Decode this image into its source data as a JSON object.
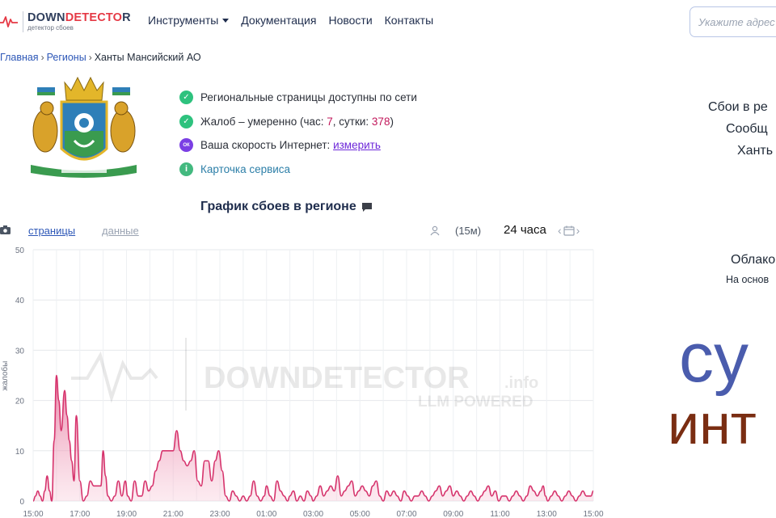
{
  "header": {
    "logo": {
      "part1": "DOWN",
      "part2": "DETECTO",
      "part3": "R",
      "sub": "детектор сбоев"
    },
    "nav": [
      {
        "label": "Инструменты",
        "dropdown": true
      },
      {
        "label": "Документация"
      },
      {
        "label": "Новости"
      },
      {
        "label": "Контакты"
      }
    ],
    "search_placeholder": "Укажите адрес"
  },
  "breadcrumb": {
    "home": "Главная",
    "regions": "Регионы",
    "current": "Ханты Мансийский АО"
  },
  "status": {
    "line1": "Региональные страницы доступны по сети",
    "line2_prefix": "Жалоб – умеренно (час: ",
    "hour_count": "7",
    "line2_mid": ", сутки: ",
    "day_count": "378",
    "line2_suffix": ")",
    "speed_badge": "ОК",
    "line3_prefix": "Ваша скорость Интернет: ",
    "line3_link": "измерить",
    "line4": "Карточка сервиса"
  },
  "right": {
    "line1": "Сбои в ре",
    "line2": "Сообщ",
    "line3": "Ханть",
    "cloud_title": "Облако",
    "cloud_sub": "На основ",
    "big_word1": "су",
    "big_word2": "инт"
  },
  "chart_header": {
    "title": "График сбоев в регионе",
    "tab_pages": "страницы",
    "tab_data": "данные",
    "interval": "(15м)",
    "period": "24 часа"
  },
  "watermark": {
    "brand": "DOWNDETECTOR",
    "domain": ".info",
    "tagline": "LLM POWERED"
  },
  "colors": {
    "accent": "#2d57b7",
    "series": "#d6336c",
    "brand_red": "#e53945"
  },
  "chart_data": {
    "type": "area",
    "ylabel": "жалобы",
    "ylim": [
      0,
      50
    ],
    "y_ticks": [
      0,
      10,
      20,
      30,
      40,
      50
    ],
    "x_labels": [
      "15:00",
      "17:00",
      "19:00",
      "21:00",
      "23:00",
      "01:00",
      "03:00",
      "05:00",
      "07:00",
      "09:00",
      "11:00",
      "13:00",
      "15:00"
    ],
    "grid": true,
    "x_hours": [
      0.0,
      0.1,
      0.2,
      0.3,
      0.4,
      0.5,
      0.6,
      0.7,
      0.8,
      0.9,
      1.0,
      1.1,
      1.2,
      1.35,
      1.45,
      1.55,
      1.65,
      1.75,
      1.85,
      2.0,
      2.15,
      2.3,
      2.45,
      2.6,
      2.75,
      2.9,
      3.0,
      3.1,
      3.2,
      3.35,
      3.5,
      3.65,
      3.8,
      3.95,
      4.05,
      4.2,
      4.35,
      4.5,
      4.65,
      4.8,
      4.95,
      5.1,
      5.25,
      5.4,
      5.55,
      5.7,
      5.85,
      6.0,
      6.15,
      6.3,
      6.45,
      6.6,
      6.75,
      6.9,
      7.05,
      7.2,
      7.35,
      7.5,
      7.65,
      7.8,
      7.95,
      8.1,
      8.25,
      8.4,
      8.55,
      8.7,
      8.85,
      9.0,
      9.15,
      9.3,
      9.45,
      9.6,
      9.75,
      9.9,
      10.0,
      10.15,
      10.3,
      10.45,
      10.6,
      10.75,
      10.9,
      11.0,
      11.15,
      11.3,
      11.45,
      11.6,
      11.75,
      11.9,
      12.0,
      12.15,
      12.3,
      12.45,
      12.6,
      12.75,
      12.9,
      13.05,
      13.2,
      13.35,
      13.5,
      13.65,
      13.8,
      13.95,
      14.1,
      14.25,
      14.4,
      14.55,
      14.7,
      14.85,
      15.0,
      15.15,
      15.3,
      15.45,
      15.6,
      15.75,
      15.9,
      16.05,
      16.2,
      16.35,
      16.5,
      16.65,
      16.8,
      16.95,
      17.1,
      17.25,
      17.4,
      17.55,
      17.7,
      17.85,
      18.0,
      18.15,
      18.3,
      18.45,
      18.6,
      18.75,
      18.9,
      19.05,
      19.2,
      19.35,
      19.5,
      19.65,
      19.8,
      19.95,
      20.1,
      20.25,
      20.4,
      20.55,
      20.7,
      20.85,
      21.0,
      21.15,
      21.3,
      21.45,
      21.6,
      21.75,
      21.85,
      21.95,
      22.05,
      22.2,
      22.35,
      22.5,
      22.65,
      22.8,
      22.95,
      23.1,
      23.25,
      23.4,
      23.55,
      23.7,
      23.9,
      24.0
    ],
    "values": [
      0,
      1,
      2,
      1,
      0,
      2,
      5,
      2,
      0,
      12,
      25,
      20,
      14,
      22,
      17,
      12,
      8,
      4,
      17,
      4,
      0,
      1,
      4,
      3,
      3,
      3,
      10,
      5,
      1,
      0,
      1,
      4,
      1,
      4,
      1,
      0,
      4,
      1,
      1,
      4,
      2,
      3,
      6,
      8,
      10,
      10,
      10,
      10,
      14,
      10,
      8,
      7,
      8,
      10,
      4,
      3,
      8,
      8,
      4,
      8,
      10,
      6,
      1,
      0,
      2,
      1,
      0,
      1,
      0,
      1,
      4,
      1,
      0,
      1,
      3,
      1,
      0,
      4,
      2,
      1,
      0,
      1,
      2,
      0,
      1,
      0,
      2,
      1,
      0,
      1,
      3,
      1,
      2,
      3,
      2,
      5,
      1,
      2,
      3,
      4,
      1,
      2,
      3,
      2,
      1,
      3,
      4,
      1,
      0,
      2,
      1,
      2,
      1,
      0,
      2,
      1,
      0,
      1,
      1,
      2,
      1,
      0,
      1,
      2,
      3,
      1,
      2,
      3,
      1,
      2,
      1,
      0,
      1,
      2,
      1,
      0,
      1,
      2,
      3,
      1,
      2,
      0,
      1,
      1,
      0,
      1,
      2,
      1,
      0,
      1,
      3,
      2,
      1,
      2,
      3,
      1,
      0,
      1,
      2,
      1,
      0,
      1,
      2,
      1,
      0,
      1,
      2,
      1,
      1,
      2,
      4,
      4
    ]
  }
}
